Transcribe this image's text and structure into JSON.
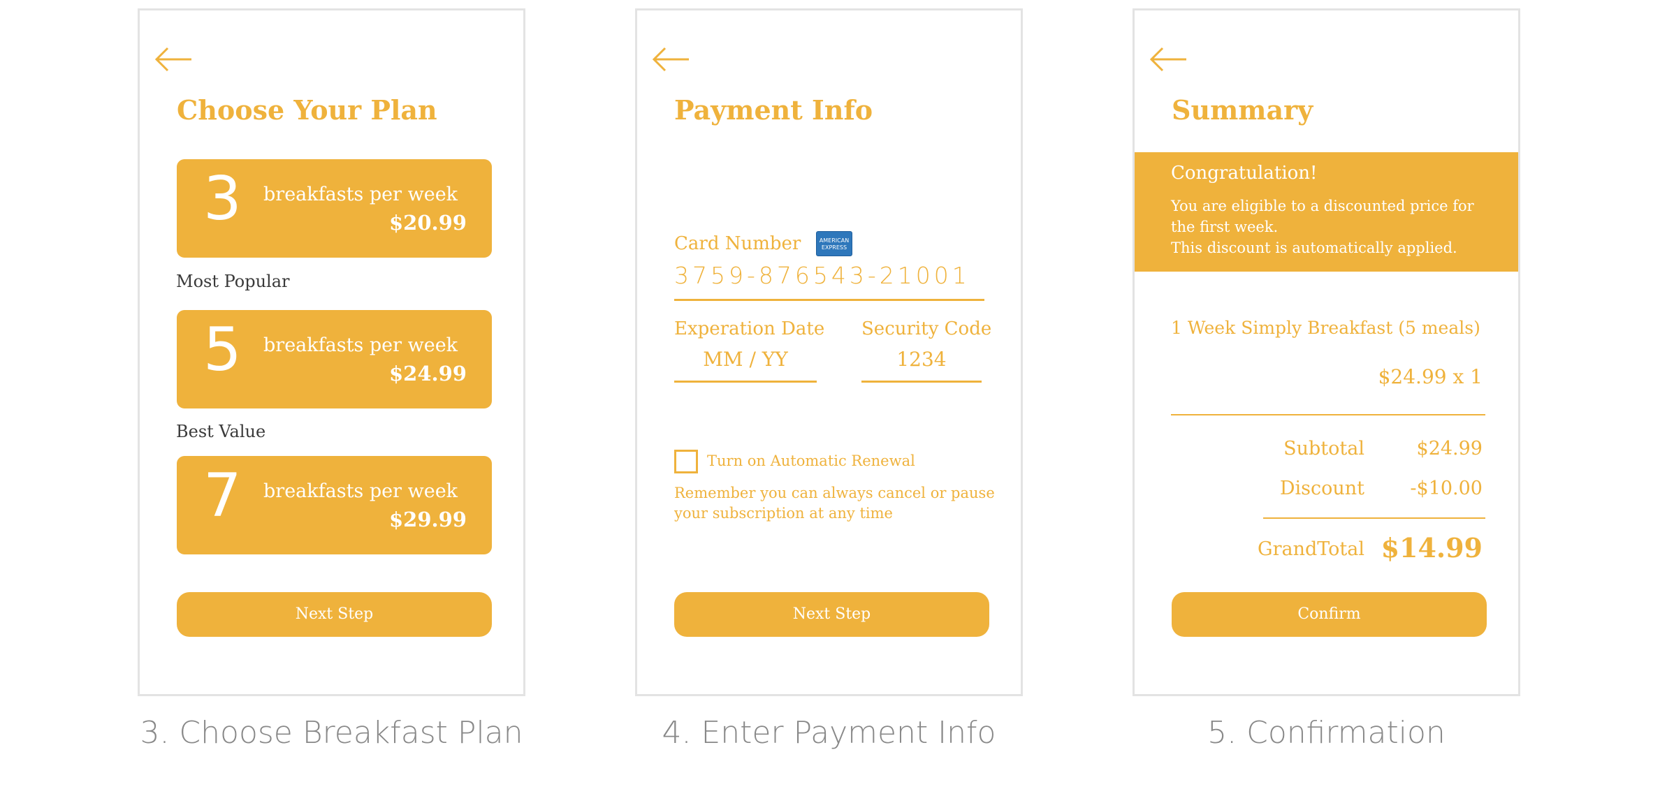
{
  "colors": {
    "accent": "#EFB23C",
    "caption_gray": "#888888",
    "frame_border": "#E3E3E3",
    "amex_blue": "#2E77BB"
  },
  "screen_choose_plan": {
    "back_icon": "arrow-left-icon",
    "title": "Choose Your Plan",
    "plans": [
      {
        "count": "3",
        "text": "breakfasts per week",
        "price": "$20.99"
      },
      {
        "count": "5",
        "text": "breakfasts per week",
        "price": "$24.99"
      },
      {
        "count": "7",
        "text": "breakfasts per week",
        "price": "$29.99"
      }
    ],
    "tags": {
      "most_popular": "Most Popular",
      "best_value": "Best Value"
    },
    "next_button": "Next Step",
    "caption": "3. Choose Breakfast Plan"
  },
  "screen_payment": {
    "back_icon": "arrow-left-icon",
    "title": "Payment Info",
    "card_label": "Card Number",
    "card_brand": "AMERICAN EXPRESS",
    "card_number": "3759-876543-21001",
    "exp_label": "Experation Date",
    "exp_placeholder": "MM  /  YY",
    "security_label": "Security Code",
    "security_value": "1234",
    "renewal_label": "Turn on Automatic Renewal",
    "renewal_checked": false,
    "renewal_note": "Remember you can always cancel or pause your subscription at any time",
    "next_button": "Next Step",
    "caption": "4. Enter Payment Info"
  },
  "screen_summary": {
    "back_icon": "arrow-left-icon",
    "title": "Summary",
    "banner_heading": "Congratulation!",
    "banner_line1": "You are eligible to a discounted price for the first week.",
    "banner_line2": "This discount is automatically applied.",
    "item": "1 Week Simply Breakfast (5 meals)",
    "item_price": "$24.99 x 1",
    "subtotal_label": "Subtotal",
    "subtotal_value": "$24.99",
    "discount_label": "Discount",
    "discount_value": "-$10.00",
    "grand_label": "GrandTotal",
    "grand_value": "$14.99",
    "confirm_button": "Confirm",
    "caption": "5. Confirmation"
  }
}
